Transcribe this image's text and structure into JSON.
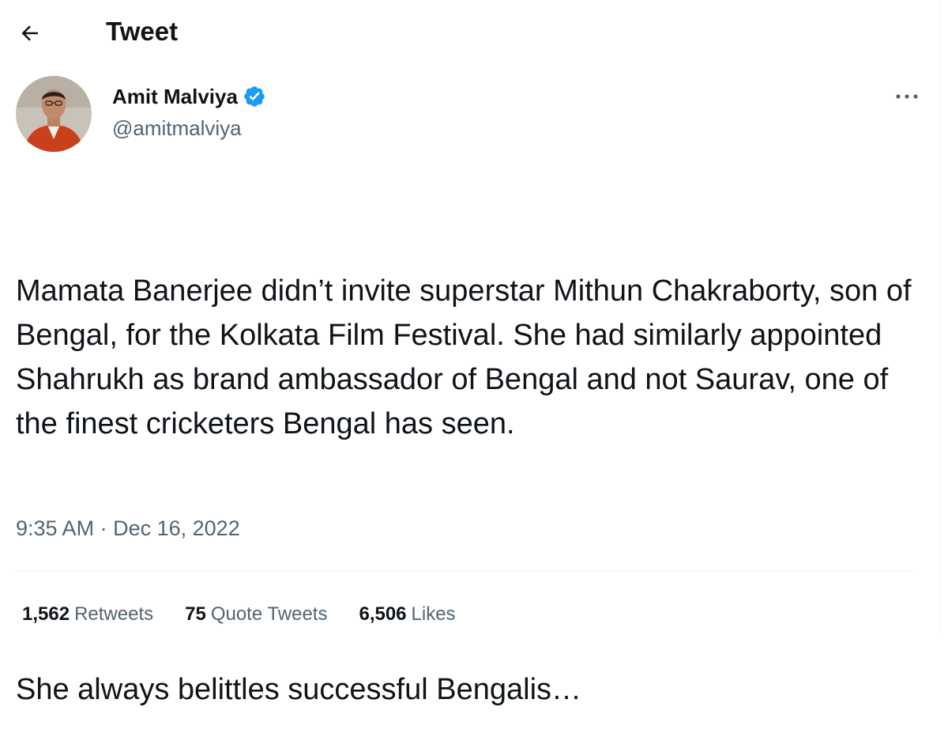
{
  "header": {
    "title": "Tweet",
    "back_icon": "arrow-left-icon"
  },
  "author": {
    "name": "Amit Malviya",
    "handle": "@amitmalviya",
    "verified": true,
    "verified_color": "#1d9bf0"
  },
  "tweet": {
    "paragraphs": [
      "Mamata Banerjee didn’t invite superstar Mithun Chakraborty, son of Bengal, for the Kolkata Film Festival. She had similarly appointed Shahrukh as brand ambassador of Bengal and not Saurav, one of the finest cricketers Bengal has seen.",
      "She always belittles successful Bengalis…"
    ],
    "time": "9:35 AM",
    "separator": "·",
    "date": "Dec 16, 2022"
  },
  "stats": {
    "retweets_count": "1,562",
    "retweets_label": "Retweets",
    "quotes_count": "75",
    "quotes_label": "Quote Tweets",
    "likes_count": "6,506",
    "likes_label": "Likes"
  },
  "colors": {
    "text_primary": "#0f1419",
    "text_secondary": "#536471",
    "divider": "#eff3f4"
  }
}
